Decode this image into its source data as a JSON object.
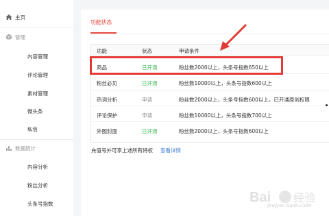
{
  "sidebar": {
    "home": {
      "label": "主页",
      "icon": "home-icon"
    },
    "manage": {
      "label": "管理",
      "icon": "cube-icon"
    },
    "manage_items": [
      {
        "label": "内容管理"
      },
      {
        "label": "评论管理"
      },
      {
        "label": "素材管理"
      },
      {
        "label": "微头条"
      },
      {
        "label": "私信"
      }
    ],
    "stats": {
      "label": "数据统计",
      "icon": "bar-chart-icon"
    },
    "stats_items": [
      {
        "label": "内容分析"
      },
      {
        "label": "粉丝分析"
      },
      {
        "label": "头条号指数"
      }
    ]
  },
  "main": {
    "tab_label": "功能状态",
    "table": {
      "headers": {
        "function": "功能",
        "status": "状态",
        "conditions": "申请条件"
      },
      "rows": [
        {
          "function": "商品",
          "status": "已开通",
          "status_type": "on",
          "conditions": "粉丝数2000以上，头条号指数650以上"
        },
        {
          "function": "粉丝必见",
          "status": "已开通",
          "status_type": "on",
          "conditions": "粉丝数10000以上，头条号指数600以上"
        },
        {
          "function": "热词分析",
          "status": "申请",
          "status_type": "apply",
          "conditions": "粉丝数2000以上，头条号指数600以上，已开通原创权限"
        },
        {
          "function": "评论保护",
          "status": "申请",
          "status_type": "apply",
          "conditions": "粉丝数10000以上，头条号指数700以上"
        },
        {
          "function": "外图封面",
          "status": "已开通",
          "status_type": "on",
          "conditions": "粉丝数2000以上，头条号指数600以上"
        }
      ]
    },
    "footer_text": "充值号外可享上述所有特权",
    "footer_link": "查看详情"
  },
  "watermark": {
    "text": "jingyan.baidu.com"
  },
  "colors": {
    "accent": "#e84a41",
    "status_on": "#3fbe5a",
    "status_apply": "#8a8a8a",
    "link": "#3a7ad5",
    "highlight": "#e33a36"
  }
}
